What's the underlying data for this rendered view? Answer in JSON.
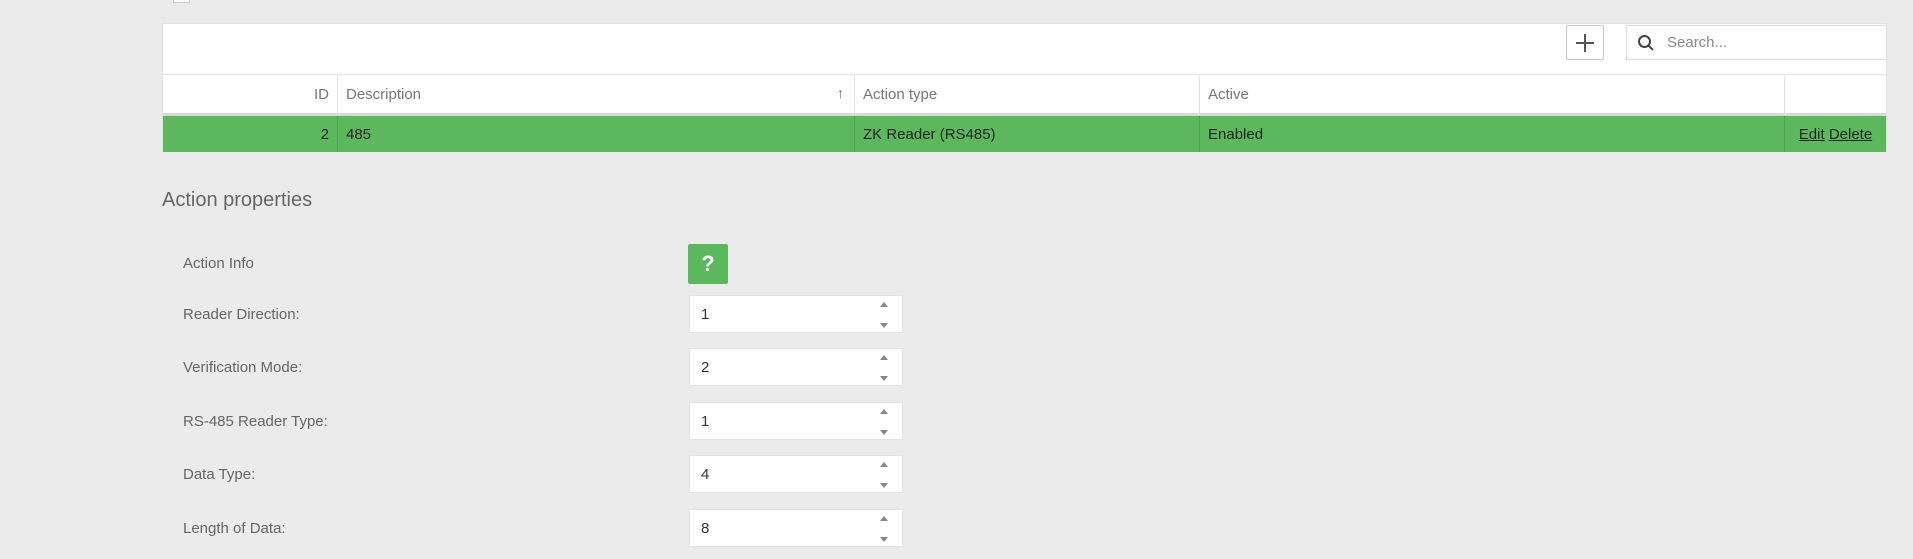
{
  "toolbar": {
    "search_placeholder": "Search..."
  },
  "table": {
    "columns": [
      "ID",
      "Description",
      "Action type",
      "Active",
      ""
    ],
    "sort_indicator": "↑",
    "selected_row": {
      "id": "2",
      "description": "485",
      "action_type": "ZK Reader (RS485)",
      "active": "Enabled",
      "edit_label": "Edit",
      "delete_label": "Delete"
    }
  },
  "properties": {
    "title": "Action properties",
    "info_label": "Action Info",
    "info_button": "?",
    "fields": [
      {
        "label": "Reader Direction:",
        "value": "1"
      },
      {
        "label": "Verification Mode:",
        "value": "2"
      },
      {
        "label": "RS-485 Reader Type:",
        "value": "1"
      },
      {
        "label": "Data Type:",
        "value": "4"
      },
      {
        "label": "Length of Data:",
        "value": "8"
      }
    ]
  },
  "colors": {
    "selected_row": "#5cb85c",
    "info_button": "#5cb85c",
    "background": "#ebebeb"
  },
  "icons": [
    "plus-icon",
    "search-icon",
    "sort-ascending-icon",
    "help-icon"
  ]
}
